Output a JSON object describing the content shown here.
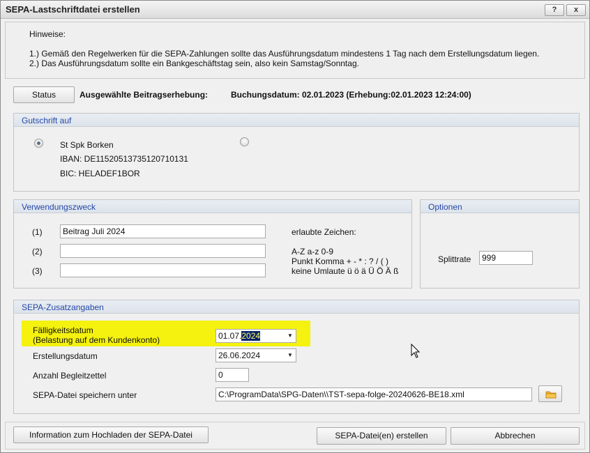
{
  "window": {
    "title": "SEPA-Lastschriftdatei erstellen",
    "help_label": "?",
    "close_label": "x"
  },
  "hints": {
    "heading": "Hinweise:",
    "line1": "1.) Gemäß den Regelwerken für die SEPA-Zahlungen sollte das Ausführungsdatum mindestens 1 Tag nach dem Erstellungsdatum liegen.",
    "line2": "2.) Das Ausführungsdatum sollte ein  Bankgeschäftstag sein, also kein Samstag/Sonntag."
  },
  "status_bar": {
    "status_label": "Status",
    "selected_label": "Ausgewählte Beitragserhebung:",
    "booking_info": "Buchungsdatum: 02.01.2023 (Erhebung:02.01.2023 12:24:00)"
  },
  "gutschrift": {
    "title": "Gutschrift auf",
    "bank_name": "St Spk Borken",
    "iban": "IBAN: DE11520513735120710131",
    "bic": "BIC: HELADEF1BOR"
  },
  "verwendungszweck": {
    "title": "Verwendungszweck",
    "rows": [
      {
        "label": "(1)",
        "value": "Beitrag Juli 2024"
      },
      {
        "label": "(2)",
        "value": ""
      },
      {
        "label": "(3)",
        "value": ""
      }
    ],
    "allowed_heading": "erlaubte Zeichen:",
    "allowed_line1": "A-Z  a-z  0-9",
    "allowed_line2": "Punkt Komma + - * : ? / ( )",
    "allowed_line3": "keine Umlaute ü ö ä Ü Ö Ä ß"
  },
  "optionen": {
    "title": "Optionen",
    "splittrate_label": "Splittrate",
    "splittrate_value": "999"
  },
  "zusatz": {
    "title": "SEPA-Zusatzangaben",
    "faellig_label1": "Fälligkeitsdatum",
    "faellig_label2": "(Belastung auf dem Kundenkonto)",
    "faellig_value_prefix": "01.07.",
    "faellig_value_selected": "2024",
    "erstellung_label": "Erstellungsdatum",
    "erstellung_value": "26.06.2024",
    "begleit_label": "Anzahl Begleitzettel",
    "begleit_value": "0",
    "speichern_label": "SEPA-Datei speichern unter",
    "speichern_value": "C:\\ProgramData\\SPG-Daten\\\\TST-sepa-folge-20240626-BE18.xml"
  },
  "footer": {
    "info_label": "Information zum Hochladen der SEPA-Datei",
    "create_label": "SEPA-Datei(en) erstellen",
    "cancel_label": "Abbrechen"
  },
  "colors": {
    "group_title": "#2447a8",
    "highlight": "#f4f20e",
    "selection": "#0a246a"
  }
}
